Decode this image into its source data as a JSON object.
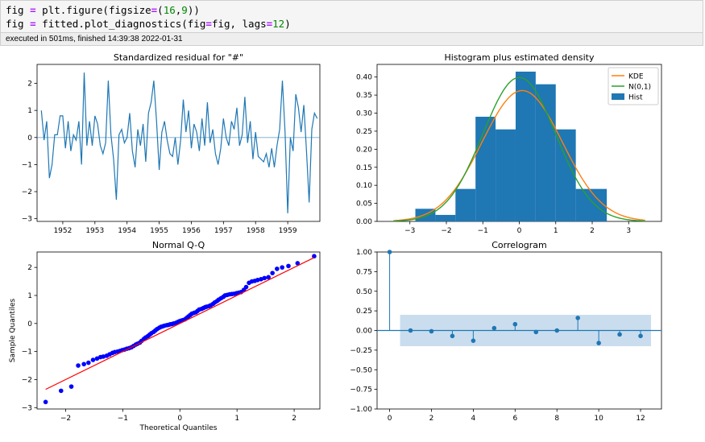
{
  "code": {
    "line1": {
      "a": "fig ",
      "eq": "=",
      "b": " plt.figure(figsize",
      "eq2": "=",
      "c": "(",
      "n1": "16",
      "d": ",",
      "n2": "9",
      "e": "))"
    },
    "line2": {
      "a": "fig ",
      "eq": "=",
      "b": " fitted.plot_diagnostics(fig",
      "eq2": "=",
      "c": "fig, lags",
      "eq3": "=",
      "n1": "12",
      "d": ")"
    }
  },
  "execution_status": "executed in 501ms, finished 14:39:38 2022-01-31",
  "colors": {
    "series": "#1f77b4",
    "kde": "#ff7f0e",
    "normal": "#2ca02c",
    "qq_points": "#0000ff",
    "qq_line": "#ff0000",
    "conf_band": "#c4d9ec"
  },
  "chart_data": [
    {
      "type": "line",
      "title": "Standardized residual for \"#\"",
      "xlabel": "",
      "ylabel": "",
      "xlim": [
        1951.2,
        1960.0
      ],
      "ylim": [
        -3.1,
        2.7
      ],
      "x_ticks": [
        "1952",
        "1953",
        "1954",
        "1955",
        "1956",
        "1957",
        "1958",
        "1959"
      ],
      "y_ticks": [
        -3,
        -2,
        -1,
        0,
        1,
        2
      ],
      "hline": 0,
      "x": [
        1951.333,
        1951.417,
        1951.5,
        1951.583,
        1951.667,
        1951.75,
        1951.833,
        1951.917,
        1952.0,
        1952.083,
        1952.167,
        1952.25,
        1952.333,
        1952.417,
        1952.5,
        1952.583,
        1952.667,
        1952.75,
        1952.833,
        1952.917,
        1953.0,
        1953.083,
        1953.167,
        1953.25,
        1953.333,
        1953.417,
        1953.5,
        1953.583,
        1953.667,
        1953.75,
        1953.833,
        1953.917,
        1954.0,
        1954.083,
        1954.167,
        1954.25,
        1954.333,
        1954.417,
        1954.5,
        1954.583,
        1954.667,
        1954.75,
        1954.833,
        1954.917,
        1955.0,
        1955.083,
        1955.167,
        1955.25,
        1955.333,
        1955.417,
        1955.5,
        1955.583,
        1955.667,
        1955.75,
        1955.833,
        1955.917,
        1956.0,
        1956.083,
        1956.167,
        1956.25,
        1956.333,
        1956.417,
        1956.5,
        1956.583,
        1956.667,
        1956.75,
        1956.833,
        1956.917,
        1957.0,
        1957.083,
        1957.167,
        1957.25,
        1957.333,
        1957.417,
        1957.5,
        1957.583,
        1957.667,
        1957.75,
        1957.833,
        1957.917,
        1958.0,
        1958.083,
        1958.167,
        1958.25,
        1958.333,
        1958.417,
        1958.5,
        1958.583,
        1958.667,
        1958.75,
        1958.833,
        1958.917,
        1959.0,
        1959.083,
        1959.167,
        1959.25,
        1959.333,
        1959.417,
        1959.5,
        1959.583,
        1959.667,
        1959.75,
        1959.833,
        1959.917
      ],
      "values": [
        1.0,
        -0.1,
        0.6,
        -1.5,
        -1.0,
        0.1,
        0.1,
        0.8,
        0.8,
        -0.4,
        0.6,
        -0.5,
        0.1,
        -0.1,
        0.6,
        -1.0,
        2.4,
        -0.3,
        0.6,
        -0.3,
        0.8,
        0.5,
        -0.3,
        -0.6,
        -0.2,
        2.1,
        0.1,
        -0.8,
        -2.3,
        0.1,
        0.3,
        -0.2,
        0.0,
        0.9,
        -0.5,
        -1.1,
        0.3,
        -0.3,
        0.5,
        -0.9,
        0.9,
        1.3,
        2.1,
        0.6,
        -1.2,
        0.2,
        0.6,
        -0.1,
        -0.6,
        -0.7,
        0.0,
        -1.0,
        -0.1,
        1.4,
        0.2,
        1.0,
        -0.4,
        0.5,
        0.2,
        -0.5,
        0.7,
        -0.3,
        1.3,
        -0.2,
        0.3,
        -0.6,
        -1.0,
        -0.4,
        0.7,
        0.0,
        -0.3,
        0.6,
        0.3,
        1.1,
        -0.3,
        0.1,
        1.5,
        -0.2,
        0.6,
        -0.8,
        0.2,
        -0.7,
        -0.8,
        -0.9,
        -0.6,
        -1.1,
        -0.4,
        -1.1,
        -0.3,
        0.3,
        2.1,
        0.2,
        -2.8,
        0.0,
        -0.5,
        1.6,
        1.1,
        0.2,
        1.2,
        -0.5,
        -2.4,
        0.3,
        0.9,
        0.7,
        -0.1,
        1.5
      ]
    },
    {
      "type": "histogram",
      "title": "Histogram plus estimated density",
      "xlim": [
        -3.9,
        3.9
      ],
      "ylim": [
        0,
        0.435
      ],
      "x_ticks": [
        -3,
        -2,
        -1,
        0,
        1,
        2,
        3
      ],
      "y_ticks": [
        "0.00",
        "0.05",
        "0.10",
        "0.15",
        "0.20",
        "0.25",
        "0.30",
        "0.35",
        "0.40"
      ],
      "legend_position": "upper right",
      "legend": [
        "KDE",
        "N(0,1)",
        "Hist"
      ],
      "bins": [
        {
          "x0": -2.85,
          "x1": -2.3,
          "value": 0.035
        },
        {
          "x0": -2.3,
          "x1": -1.75,
          "value": 0.018
        },
        {
          "x0": -1.75,
          "x1": -1.2,
          "value": 0.09
        },
        {
          "x0": -1.2,
          "x1": -0.65,
          "value": 0.29
        },
        {
          "x0": -0.65,
          "x1": -0.1,
          "value": 0.255
        },
        {
          "x0": -0.1,
          "x1": 0.45,
          "value": 0.415
        },
        {
          "x0": 0.45,
          "x1": 1.0,
          "value": 0.38
        },
        {
          "x0": 1.0,
          "x1": 1.55,
          "value": 0.255
        },
        {
          "x0": 1.55,
          "x1": 2.4,
          "value": 0.09
        }
      ],
      "kde": {
        "mean": 0.08,
        "sd": 1.1
      },
      "normal": {
        "mean": 0,
        "sd": 1
      }
    },
    {
      "type": "scatter",
      "title": "Normal Q-Q",
      "xlabel": "Theoretical Quantiles",
      "ylabel": "Sample Quantiles",
      "xlim": [
        -2.5,
        2.45
      ],
      "ylim": [
        -3.05,
        2.55
      ],
      "x_ticks": [
        -2,
        -1,
        0,
        1,
        2
      ],
      "y_ticks": [
        -3,
        -2,
        -1,
        0,
        1,
        2
      ],
      "points": {
        "x": [
          -2.35,
          -2.08,
          -1.9,
          -1.78,
          -1.68,
          -1.6,
          -1.52,
          -1.45,
          -1.39,
          -1.34,
          -1.28,
          -1.23,
          -1.18,
          -1.14,
          -1.09,
          -1.05,
          -1.01,
          -0.97,
          -0.93,
          -0.89,
          -0.85,
          -0.81,
          -0.77,
          -0.74,
          -0.7,
          -0.67,
          -0.63,
          -0.6,
          -0.56,
          -0.53,
          -0.5,
          -0.46,
          -0.43,
          -0.4,
          -0.36,
          -0.33,
          -0.3,
          -0.27,
          -0.23,
          -0.2,
          -0.17,
          -0.14,
          -0.11,
          -0.07,
          -0.04,
          -0.01,
          0.02,
          0.05,
          0.09,
          0.12,
          0.15,
          0.18,
          0.21,
          0.25,
          0.28,
          0.31,
          0.34,
          0.38,
          0.41,
          0.44,
          0.47,
          0.51,
          0.54,
          0.58,
          0.61,
          0.65,
          0.68,
          0.72,
          0.76,
          0.79,
          0.83,
          0.87,
          0.91,
          0.95,
          0.99,
          1.03,
          1.07,
          1.12,
          1.16,
          1.21,
          1.26,
          1.31,
          1.36,
          1.42,
          1.48,
          1.55,
          1.62,
          1.7,
          1.79,
          1.9,
          2.06,
          2.35
        ],
        "y": [
          -2.8,
          -2.4,
          -2.25,
          -1.5,
          -1.45,
          -1.4,
          -1.3,
          -1.25,
          -1.2,
          -1.18,
          -1.15,
          -1.1,
          -1.05,
          -1.02,
          -1.0,
          -0.98,
          -0.95,
          -0.93,
          -0.9,
          -0.88,
          -0.85,
          -0.8,
          -0.75,
          -0.72,
          -0.68,
          -0.62,
          -0.55,
          -0.5,
          -0.45,
          -0.4,
          -0.35,
          -0.3,
          -0.25,
          -0.2,
          -0.15,
          -0.12,
          -0.1,
          -0.08,
          -0.06,
          -0.05,
          -0.03,
          -0.02,
          0.0,
          0.02,
          0.05,
          0.08,
          0.1,
          0.12,
          0.15,
          0.2,
          0.25,
          0.3,
          0.35,
          0.38,
          0.4,
          0.45,
          0.5,
          0.52,
          0.55,
          0.58,
          0.6,
          0.62,
          0.65,
          0.7,
          0.75,
          0.8,
          0.85,
          0.9,
          0.95,
          1.0,
          1.02,
          1.04,
          1.05,
          1.06,
          1.08,
          1.1,
          1.12,
          1.2,
          1.3,
          1.45,
          1.5,
          1.52,
          1.55,
          1.58,
          1.62,
          1.65,
          1.8,
          1.95,
          2.0,
          2.05,
          2.15,
          2.4
        ]
      },
      "reference_line": {
        "slope": 1.0,
        "intercept": 0.0,
        "x_from": -2.35,
        "x_to": 2.35
      }
    },
    {
      "type": "stem",
      "title": "Correlogram",
      "xlim": [
        -0.6,
        13.0
      ],
      "ylim": [
        -1.0,
        1.0
      ],
      "x_ticks": [
        0,
        2,
        4,
        6,
        8,
        10,
        12
      ],
      "y_ticks": [
        "-1.00",
        "-0.75",
        "-0.50",
        "-0.25",
        "0.00",
        "0.25",
        "0.50",
        "0.75",
        "1.00"
      ],
      "lags": [
        0,
        1,
        2,
        3,
        4,
        5,
        6,
        7,
        8,
        9,
        10,
        11,
        12
      ],
      "values": [
        1.0,
        0.0,
        -0.01,
        -0.07,
        -0.13,
        0.03,
        0.08,
        -0.02,
        0.0,
        0.16,
        -0.16,
        -0.05,
        -0.07
      ],
      "confidence_band": {
        "x_from": 0.5,
        "x_to": 12.5,
        "upper": 0.2,
        "lower": -0.2
      }
    }
  ]
}
